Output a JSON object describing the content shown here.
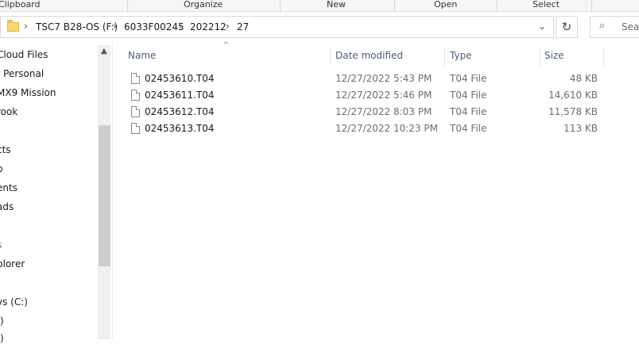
{
  "ribbon": {
    "groups": [
      "Clipboard",
      "Organize",
      "New",
      "Open",
      "Select"
    ]
  },
  "address": {
    "crumbs": [
      "TSC7 B28-OS (F:)",
      "6033F00245",
      "202212",
      "27"
    ],
    "search_placeholder": "Sear"
  },
  "nav": {
    "items": [
      "Cloud Files",
      " - Personal",
      "MX9 Mission",
      "rook",
      "cts",
      "p",
      "ents",
      "ads",
      "s",
      "plorer",
      "vs (C:)",
      ":)",
      ":)"
    ]
  },
  "columns": {
    "name": "Name",
    "date": "Date modified",
    "type": "Type",
    "size": "Size"
  },
  "files": [
    {
      "name": "02453610.T04",
      "date": "12/27/2022 5:43 PM",
      "type": "T04 File",
      "size": "48 KB"
    },
    {
      "name": "02453611.T04",
      "date": "12/27/2022 5:46 PM",
      "type": "T04 File",
      "size": "14,610 KB"
    },
    {
      "name": "02453612.T04",
      "date": "12/27/2022 8:03 PM",
      "type": "T04 File",
      "size": "11,578 KB"
    },
    {
      "name": "02453613.T04",
      "date": "12/27/2022 10:23 PM",
      "type": "T04 File",
      "size": "113 KB"
    }
  ]
}
